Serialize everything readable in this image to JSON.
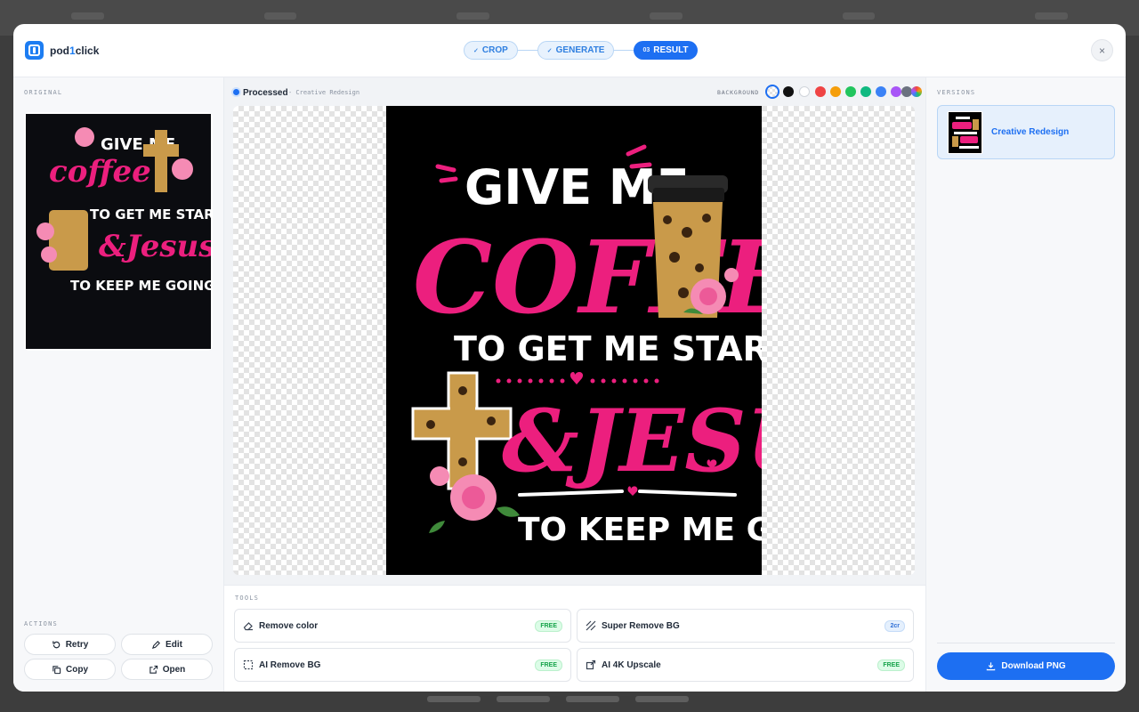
{
  "app": {
    "logo_prefix": "pod",
    "logo_accent": "1",
    "logo_suffix": "click"
  },
  "steps": [
    {
      "num": "✓",
      "label": "CROP",
      "state": "done"
    },
    {
      "num": "✓",
      "label": "GENERATE",
      "state": "done"
    },
    {
      "num": "03",
      "label": "RESULT",
      "state": "active"
    }
  ],
  "close_label": "×",
  "left": {
    "original_label": "ORIGINAL",
    "actions_label": "ACTIONS",
    "actions": {
      "retry": "Retry",
      "edit": "Edit",
      "copy": "Copy",
      "open": "Open"
    }
  },
  "center": {
    "processed_label": "Processed",
    "processed_sub": "- Creative Redesign",
    "background_label": "BACKGROUND",
    "swatches": [
      "transparent",
      "#111111",
      "#ffffff",
      "#ef4444",
      "#f59e0b",
      "#22c55e",
      "#10b981",
      "#3b82f6",
      "#a855f7",
      "#6b7280",
      "rainbow"
    ],
    "artwork": {
      "line1": "GIVE ME",
      "line2": "COFFEE",
      "line3": "TO GET ME STARTED",
      "line4": "&JESUS",
      "line5": "TO KEEP ME GOING"
    }
  },
  "tools": {
    "label": "TOOLS",
    "items": [
      {
        "label": "Remove color",
        "badge": "FREE",
        "icon": "eraser-icon"
      },
      {
        "label": "Super Remove BG",
        "badge": "2cr",
        "icon": "hatch-icon"
      },
      {
        "label": "AI Remove BG",
        "badge": "FREE",
        "icon": "dashed-square-icon"
      },
      {
        "label": "AI 4K Upscale",
        "badge": "FREE",
        "icon": "upscale-icon"
      }
    ]
  },
  "right": {
    "versions_label": "VERSIONS",
    "versions": [
      {
        "label": "Creative Redesign",
        "selected": true
      }
    ],
    "download_label": "Download PNG"
  },
  "colors": {
    "accent": "#1d6ff2",
    "pink": "#ec1f7e",
    "leopard": "#c99a4a",
    "free_badge": "#16a34a"
  }
}
